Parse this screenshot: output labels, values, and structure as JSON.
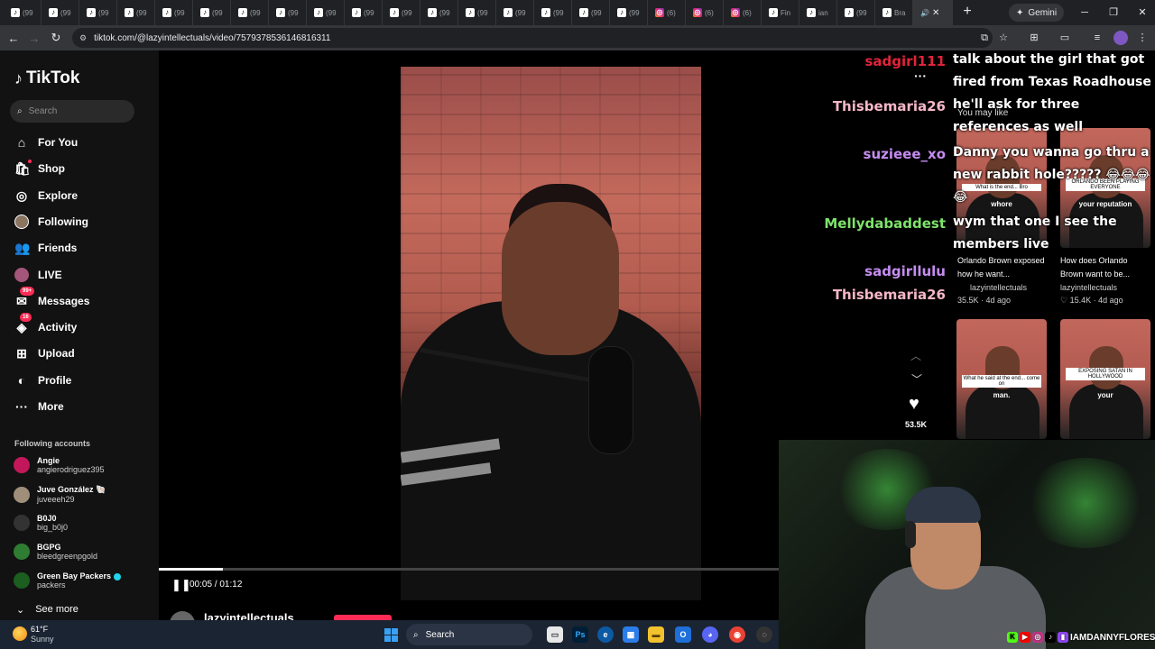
{
  "browser": {
    "tabs": [
      {
        "favicon": "tiktok-icon",
        "label": "(99"
      },
      {
        "favicon": "tiktok-icon",
        "label": "(99"
      },
      {
        "favicon": "tiktok-icon",
        "label": "(99"
      },
      {
        "favicon": "tiktok-icon",
        "label": "(99"
      },
      {
        "favicon": "tiktok-icon",
        "label": "(99"
      },
      {
        "favicon": "tiktok-icon",
        "label": "(99"
      },
      {
        "favicon": "tiktok-icon",
        "label": "(99"
      },
      {
        "favicon": "tiktok-icon",
        "label": "(99"
      },
      {
        "favicon": "tiktok-icon",
        "label": "(99"
      },
      {
        "favicon": "tiktok-icon",
        "label": "(99"
      },
      {
        "favicon": "tiktok-icon",
        "label": "(99"
      },
      {
        "favicon": "tiktok-icon",
        "label": "(99"
      },
      {
        "favicon": "tiktok-icon",
        "label": "(99"
      },
      {
        "favicon": "tiktok-icon",
        "label": "(99"
      },
      {
        "favicon": "tiktok-icon",
        "label": "(99"
      },
      {
        "favicon": "tiktok-icon",
        "label": "(99"
      },
      {
        "favicon": "tiktok-icon",
        "label": "(99"
      },
      {
        "favicon": "instagram-icon",
        "label": "(6)"
      },
      {
        "favicon": "instagram-icon",
        "label": "(6)"
      },
      {
        "favicon": "instagram-icon",
        "label": "(6)"
      },
      {
        "favicon": "tiktok-icon",
        "label": "Fin"
      },
      {
        "favicon": "tiktok-icon",
        "label": "ian"
      },
      {
        "favicon": "tiktok-icon",
        "label": "(99"
      },
      {
        "favicon": "tiktok-icon",
        "label": "Bra"
      }
    ],
    "new_tab": "+",
    "gemini_label": "Gemini",
    "url": "tiktok.com/@lazyintellectuals/video/7579378536146816311"
  },
  "tiktok": {
    "logo_text": "TikTok",
    "search_placeholder": "Search",
    "nav": [
      {
        "label": "For You",
        "icon": "home-icon"
      },
      {
        "label": "Shop",
        "icon": "shop-icon"
      },
      {
        "label": "Explore",
        "icon": "compass-icon"
      },
      {
        "label": "Following",
        "icon": "following-avatar-icon"
      },
      {
        "label": "Friends",
        "icon": "friends-icon"
      },
      {
        "label": "LIVE",
        "icon": "live-icon"
      },
      {
        "label": "Messages",
        "icon": "messages-icon",
        "badge": "99+"
      },
      {
        "label": "Activity",
        "icon": "activity-icon",
        "badge": "16"
      },
      {
        "label": "Upload",
        "icon": "upload-icon"
      },
      {
        "label": "Profile",
        "icon": "profile-icon"
      },
      {
        "label": "More",
        "icon": "more-icon"
      }
    ],
    "following_title": "Following accounts",
    "accounts": [
      {
        "name": "Angie",
        "handle": "angierodriguez395",
        "color": "#c2185b"
      },
      {
        "name": "Juve González 🐚",
        "handle": "juveeeh29",
        "color": "#9e8e7a"
      },
      {
        "name": "B0J0",
        "handle": "big_b0j0",
        "color": "#333333"
      },
      {
        "name": "BGPG",
        "handle": "bleedgreenpgold",
        "color": "#2e7d32"
      },
      {
        "name": "Green Bay Packers",
        "handle": "packers",
        "color": "#1b5e20",
        "verified": true
      }
    ],
    "see_more": "See more"
  },
  "video": {
    "time": "00:05 / 01:12",
    "progress": 0.104,
    "creator": "lazyintellectuals"
  },
  "side": {
    "more": "···",
    "you_may_like": "You may like",
    "likes": "53.5K",
    "related": [
      {
        "caption": "What is the end... Bro",
        "word": "whore"
      },
      {
        "caption": "ORLANDO BEEN PLAYING EVERYONE",
        "word": "your reputation"
      },
      {
        "caption": "What he said at the end... come on",
        "word": "man."
      },
      {
        "caption": "EXPOSING SATAN IN HOLLYWOOD",
        "word": "your"
      }
    ],
    "video1_title": "Orlando Brown exposed how he want...",
    "video1_author": "lazyintellectuals",
    "video1_meta": "35.5K · 4d ago",
    "video2_title": "How does Orlando Brown want to be...",
    "video2_author": "lazyintellectuals",
    "video2_meta": "♡ 15.4K · 4d ago"
  },
  "chat": [
    {
      "user": "sadgirl111",
      "user_color": "#e0243a",
      "msg": "talk about the girl that got fired from Texas Roadhouse"
    },
    {
      "user": "Thisbemaria26",
      "user_color": "#f6b7c8",
      "msg": "he'll ask for three references as well"
    },
    {
      "user": "suzieee_xo",
      "user_color": "#c58cf0",
      "msg": "Danny you wanna go thru a new rabbit hole????? 😂😂😂😂"
    },
    {
      "user": "Mellydabaddest",
      "user_color": "#7ee36a",
      "msg": "wym that one I see the members live"
    },
    {
      "user": "sadgirllulu",
      "user_color": "#c58cf0",
      "msg": ""
    },
    {
      "user": "Thisbemaria26",
      "user_color": "#f6b7c8",
      "msg": ""
    }
  ],
  "stream": {
    "handle": "IAMDANNYFLORES"
  },
  "taskbar": {
    "temp": "61°F",
    "condition": "Sunny",
    "search": "Search"
  }
}
